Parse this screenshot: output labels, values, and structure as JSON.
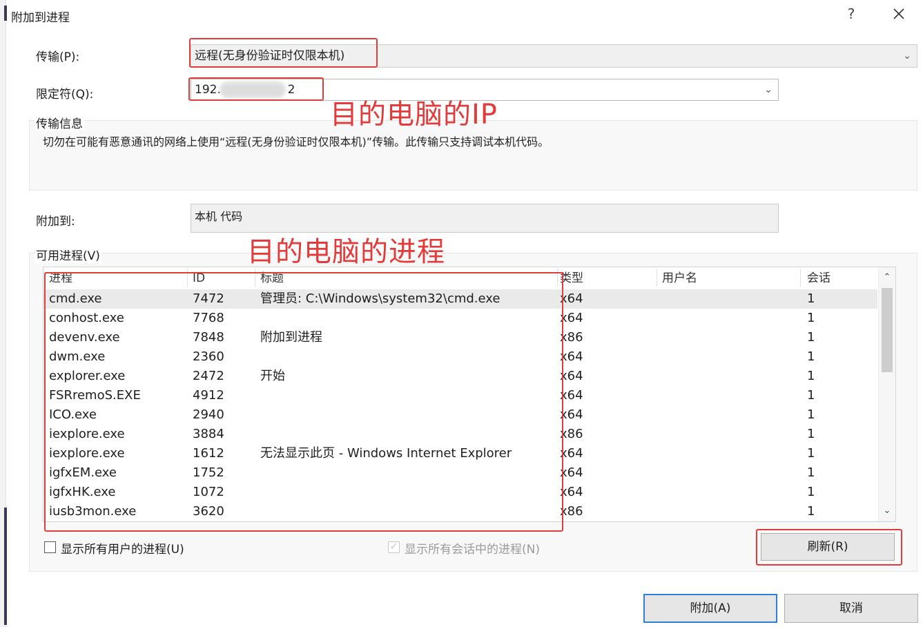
{
  "window": {
    "title": "附加到进程",
    "help_label": "?"
  },
  "transport": {
    "label": "传输(P):",
    "value": "远程(无身份验证时仅限本机)"
  },
  "qualifier": {
    "label": "限定符(Q):",
    "value_prefix": "192.",
    "value_suffix": "2"
  },
  "transport_info": {
    "label": "传输信息",
    "text": "切勿在可能有恶意通讯的网络上使用“远程(无身份验证时仅限本机)”传输。此传输只支持调试本机代码。"
  },
  "attach_to": {
    "label": "附加到:",
    "value": "本机 代码"
  },
  "processes": {
    "label": "可用进程(V)",
    "columns": [
      "进程",
      "ID",
      "标题",
      "类型",
      "用户名",
      "会话"
    ],
    "rows": [
      {
        "name": "cmd.exe",
        "id": "7472",
        "title": "管理员: C:\\Windows\\system32\\cmd.exe",
        "type": "x64",
        "user": "",
        "session": "1"
      },
      {
        "name": "conhost.exe",
        "id": "7768",
        "title": "",
        "type": "x64",
        "user": "",
        "session": "1"
      },
      {
        "name": "devenv.exe",
        "id": "7848",
        "title": "附加到进程",
        "type": "x86",
        "user": "",
        "session": "1"
      },
      {
        "name": "dwm.exe",
        "id": "2360",
        "title": "",
        "type": "x64",
        "user": "",
        "session": "1"
      },
      {
        "name": "explorer.exe",
        "id": "2472",
        "title": "开始",
        "type": "x64",
        "user": "",
        "session": "1"
      },
      {
        "name": "FSRremoS.EXE",
        "id": "4912",
        "title": "",
        "type": "x64",
        "user": "",
        "session": "1"
      },
      {
        "name": "ICO.exe",
        "id": "2940",
        "title": "",
        "type": "x64",
        "user": "",
        "session": "1"
      },
      {
        "name": "iexplore.exe",
        "id": "3884",
        "title": "",
        "type": "x86",
        "user": "",
        "session": "1"
      },
      {
        "name": "iexplore.exe",
        "id": "1612",
        "title": "无法显示此页 - Windows Internet Explorer",
        "type": "x64",
        "user": "",
        "session": "1"
      },
      {
        "name": "igfxEM.exe",
        "id": "1752",
        "title": "",
        "type": "x64",
        "user": "",
        "session": "1"
      },
      {
        "name": "igfxHK.exe",
        "id": "1072",
        "title": "",
        "type": "x64",
        "user": "",
        "session": "1"
      },
      {
        "name": "iusb3mon.exe",
        "id": "3620",
        "title": "",
        "type": "x86",
        "user": "",
        "session": "1"
      }
    ]
  },
  "options": {
    "show_all_users": "显示所有用户的进程(U)",
    "show_all_sessions": "显示所有会话中的进程(N)"
  },
  "buttons": {
    "refresh": "刷新(R)",
    "attach": "附加(A)",
    "cancel": "取消"
  },
  "annotations": {
    "target_ip": "目的电脑的IP",
    "target_process": "目的电脑的进程"
  },
  "colors": {
    "annotation_red": "#e23b3b",
    "default_button_border": "#2f7fd6"
  }
}
